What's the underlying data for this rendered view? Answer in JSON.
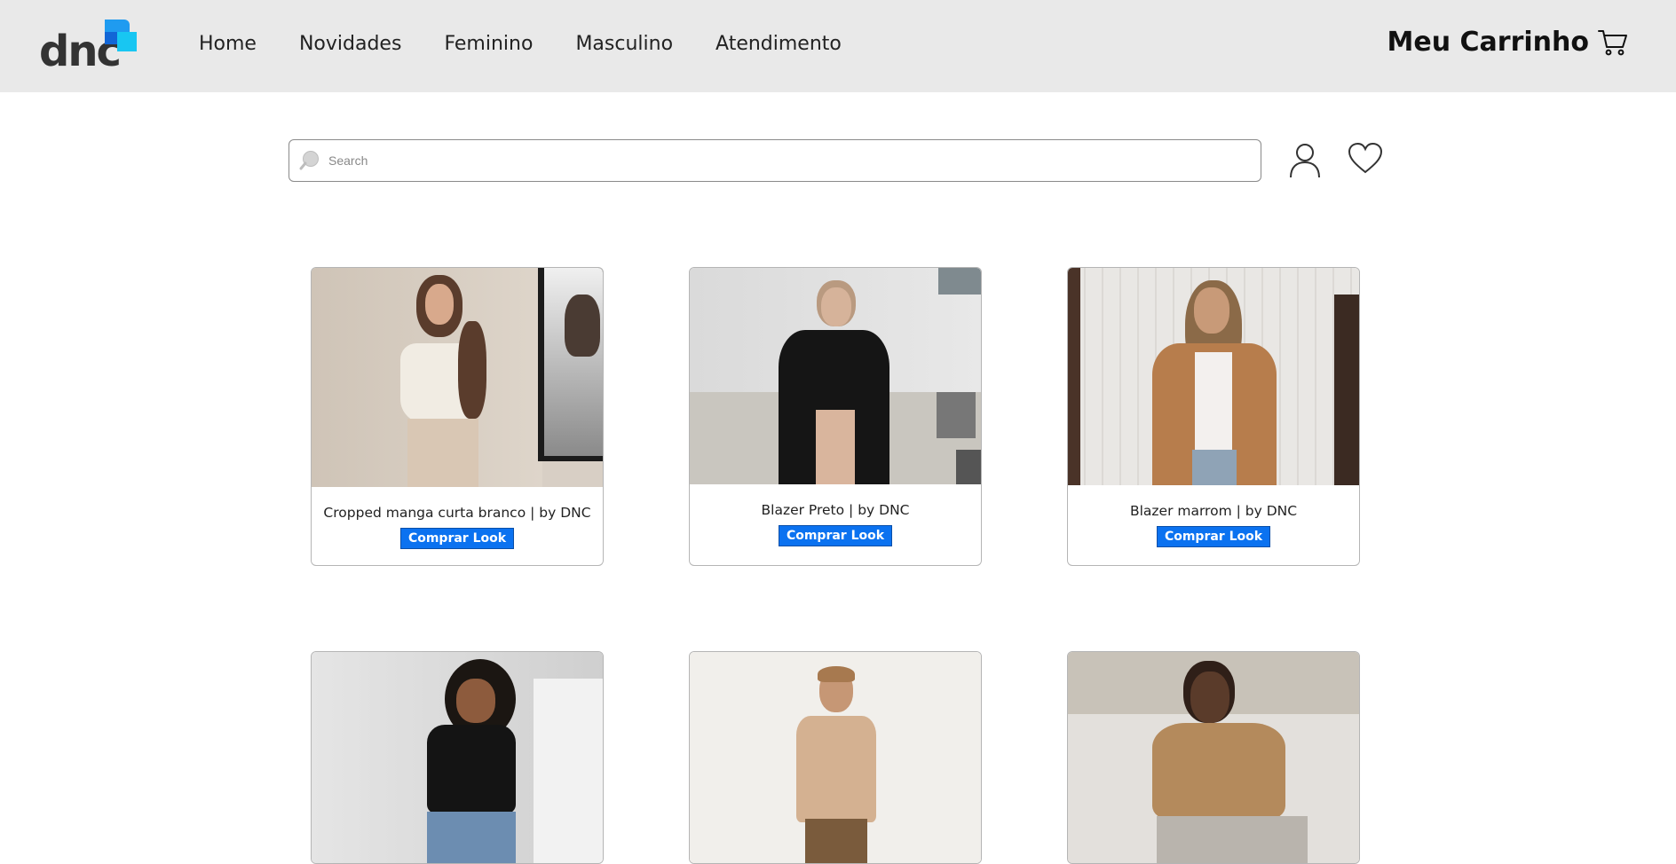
{
  "header": {
    "logo_text": "dnc",
    "nav": [
      "Home",
      "Novidades",
      "Feminino",
      "Masculino",
      "Atendimento"
    ],
    "cart_label": "Meu Carrinho",
    "colors": {
      "background": "#e9e9e9",
      "logo_blue": "#1f9bf0",
      "logo_cyan": "#18c6f2"
    }
  },
  "search": {
    "placeholder": "Search",
    "value": ""
  },
  "icons": {
    "search": "search-icon",
    "user": "user-icon",
    "favorites": "heart-icon",
    "cart": "cart-icon"
  },
  "products": [
    {
      "caption": "Cropped manga curta branco | by DNC",
      "button": "Comprar Look"
    },
    {
      "caption": "Blazer Preto | by DNC",
      "button": "Comprar Look"
    },
    {
      "caption": "Blazer marrom | by DNC",
      "button": "Comprar Look"
    },
    {
      "caption": "",
      "button": ""
    },
    {
      "caption": "",
      "button": ""
    },
    {
      "caption": "",
      "button": ""
    }
  ],
  "accent_color": "#0b72f0"
}
